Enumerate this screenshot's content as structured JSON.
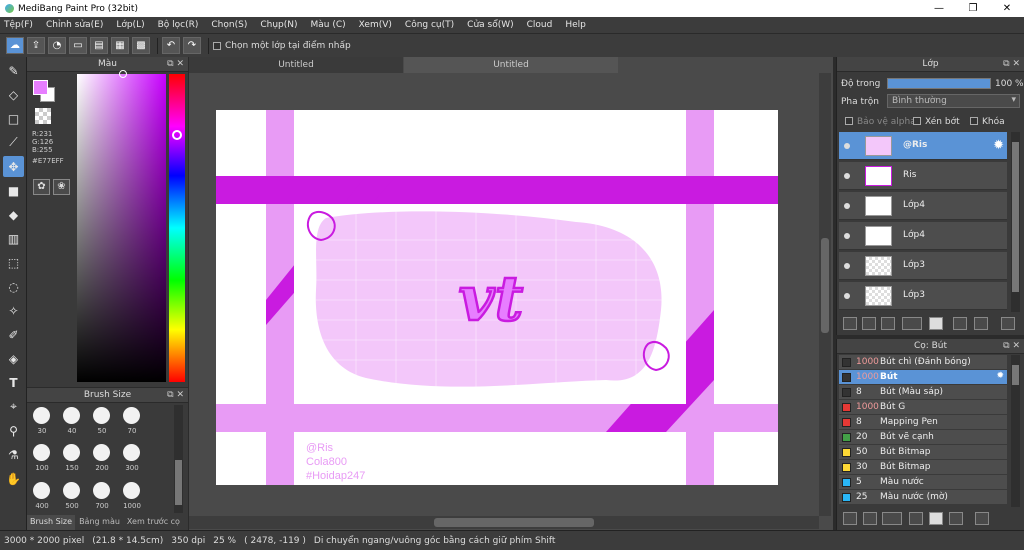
{
  "window": {
    "title": "MediBang Paint Pro (32bit)",
    "minimize": "—",
    "maximize": "❐",
    "close": "✕"
  },
  "menu": [
    "Tệp(F)",
    "Chỉnh sửa(E)",
    "Lớp(L)",
    "Bộ lọc(R)",
    "Chọn(S)",
    "Chụp(N)",
    "Màu (C)",
    "Xem(V)",
    "Công cụ(T)",
    "Cửa sổ(W)",
    "Cloud",
    "Help"
  ],
  "toolbar": {
    "select_layer_label": "Chọn một lớp tại điểm nhấp"
  },
  "color_panel": {
    "title": "Màu",
    "r": "R:231",
    "g": "G:126",
    "b": "B:255",
    "hex": "#E77EFF",
    "foreground": "#e77eff"
  },
  "brush_size_panel": {
    "title": "Brush Size",
    "sizes": [
      "30",
      "40",
      "50",
      "70",
      "100",
      "150",
      "200",
      "300",
      "400",
      "500",
      "700",
      "1000"
    ],
    "tabs": [
      "Brush Size",
      "Bảng màu",
      "Xem trước cọ"
    ]
  },
  "document_tabs": [
    "Untitled",
    "Untitled"
  ],
  "canvas": {
    "text_main": "vt",
    "credit_lines": [
      "@Ris",
      "Cola800",
      "#Hoidap247"
    ],
    "accent": "#c91be0",
    "light": "#e89bf5"
  },
  "layer_panel": {
    "title": "Lớp",
    "opacity_label": "Độ trong",
    "opacity_value": "100 %",
    "blend_label": "Pha trộn",
    "blend_value": "Bình thường",
    "protect_alpha": "Bảo vệ alpha",
    "clipping": "Xén bớt",
    "lock": "Khóa",
    "layers": [
      "@Ris",
      "Ris",
      "Lớp4",
      "Lớp4",
      "Lớp3",
      "Lớp3"
    ]
  },
  "brush_list": {
    "title": "Cọ: Bút",
    "items": [
      {
        "size": "1000",
        "name": "Bút chì (Đánh bóng)",
        "color": "#333333"
      },
      {
        "size": "1000",
        "name": "Bút",
        "color": "#333333"
      },
      {
        "size": "8",
        "name": "Bút (Màu sáp)",
        "color": "#333333"
      },
      {
        "size": "1000",
        "name": "Bút G",
        "color": "#e53935"
      },
      {
        "size": "8",
        "name": "Mapping Pen",
        "color": "#e53935"
      },
      {
        "size": "20",
        "name": "Bút vẽ cạnh",
        "color": "#43a047"
      },
      {
        "size": "50",
        "name": "Bút Bitmap",
        "color": "#fdd835"
      },
      {
        "size": "30",
        "name": "Bút Bitmap",
        "color": "#fdd835"
      },
      {
        "size": "5",
        "name": "Màu nước",
        "color": "#29b6f6"
      },
      {
        "size": "25",
        "name": "Màu nước (mờ)",
        "color": "#29b6f6"
      }
    ]
  },
  "status": {
    "size": "3000 * 2000 pixel",
    "cm": "(21.8 * 14.5cm)",
    "dpi": "350 dpi",
    "zoom": "25 %",
    "coords": "( 2478, -119 )",
    "hint": "Di chuyển ngang/vuông góc bằng cách giữ phím Shift"
  }
}
